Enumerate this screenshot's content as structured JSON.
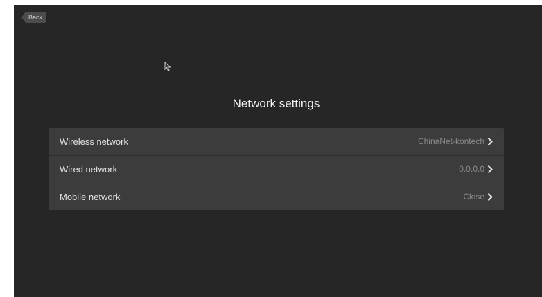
{
  "header": {
    "back_label": "Back"
  },
  "page": {
    "title": "Network settings"
  },
  "rows": [
    {
      "label": "Wireless network",
      "value": "ChinaNet-kontech"
    },
    {
      "label": "Wired network",
      "value": "0.0.0.0"
    },
    {
      "label": "Mobile network",
      "value": "Close"
    }
  ],
  "icons": {
    "back": "arrow-back-tag",
    "cursor": "mouse-pointer-icon",
    "row_arrow": "chevron-right-icon"
  },
  "colors": {
    "background": "#262626",
    "list_background": "#3c3c3c",
    "label_text": "#e0e0e0",
    "value_text": "#8a8a8a"
  }
}
